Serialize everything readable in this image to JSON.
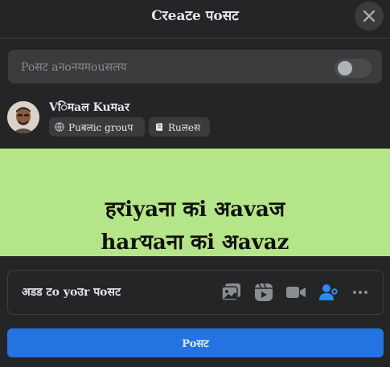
{
  "dialog": {
    "title": "Cरeaटe पoसट",
    "close_icon": "close-icon"
  },
  "anonymous": {
    "label": "Poसट aनoनयमouसलय",
    "toggle_on": false
  },
  "user": {
    "name": "Vिमaल Kuमaर",
    "audience_label": "Puबलic grouप",
    "audience_icon": "globe-icon",
    "rules_label": "Ruलeस",
    "rules_icon": "rules-book-icon"
  },
  "banner": {
    "background": "#b5e589",
    "line1": "हरiyaना कi अavaज",
    "line2": "harयaना कi अavaz"
  },
  "add_to_post": {
    "label": "अडड टo yoउr पoसट",
    "icons": [
      "photo-video-icon",
      "reel-icon",
      "live-video-icon",
      "tag-people-icon",
      "more-icon"
    ]
  },
  "actions": {
    "post_label": "Poसट",
    "post_color": "#2374e1"
  }
}
